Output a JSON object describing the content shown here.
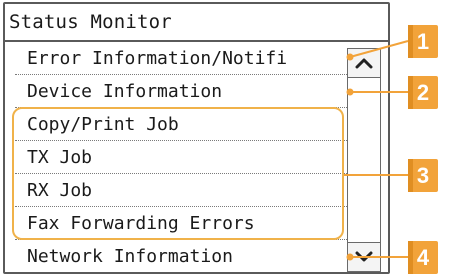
{
  "screen": {
    "title": "Status Monitor",
    "items": [
      {
        "label": "Error Information/Notifi"
      },
      {
        "label": "Device Information"
      },
      {
        "label": "Copy/Print Job"
      },
      {
        "label": "TX Job"
      },
      {
        "label": "RX Job"
      },
      {
        "label": "Fax Forwarding Errors"
      },
      {
        "label": "Network Information"
      }
    ],
    "scroll_up_icon": "chevron-up-icon",
    "scroll_down_icon": "chevron-down-icon"
  },
  "callouts": [
    {
      "number": "1"
    },
    {
      "number": "2"
    },
    {
      "number": "3"
    },
    {
      "number": "4"
    }
  ],
  "colors": {
    "callout": "#f2a33a",
    "highlight_border": "#f0b24a",
    "screen_border": "#5a5a5a"
  }
}
